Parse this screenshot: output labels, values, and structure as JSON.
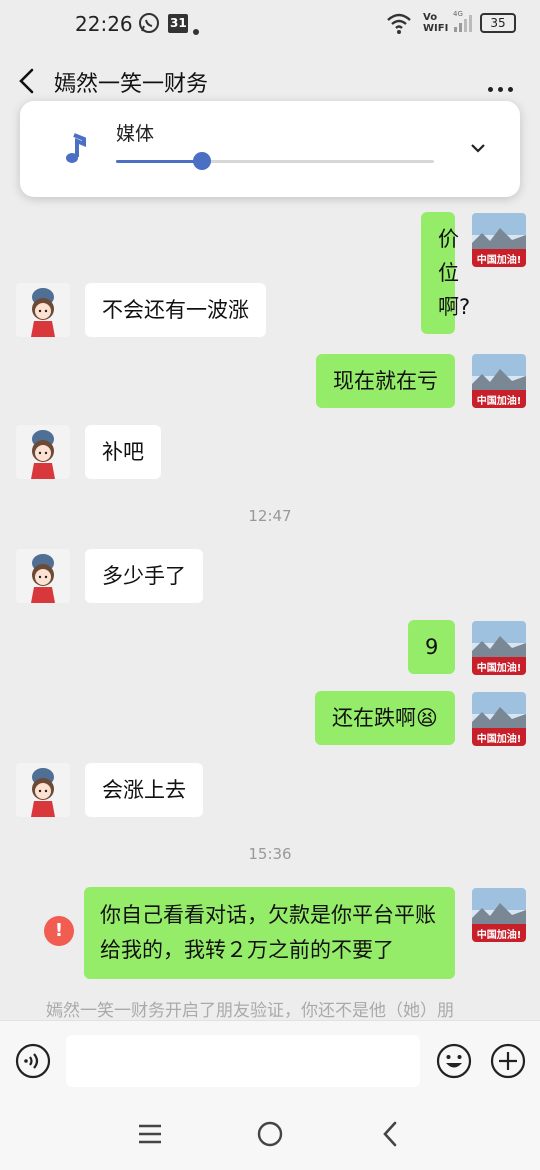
{
  "status_bar": {
    "time": "22:26",
    "calendar_day": "31",
    "network_label_top": "Vo",
    "network_label_bottom": "WIFI",
    "signal_label": "4G",
    "battery": "35"
  },
  "header": {
    "title": "嫣然一笑一财务",
    "back_icon": "chevron-left-icon",
    "more_icon": "more-dots-icon"
  },
  "media_panel": {
    "label": "媒体",
    "volume_level": 0.27,
    "accent_color": "#4a6fc3"
  },
  "messages": [
    {
      "side": "out",
      "text": "价位啊?"
    },
    {
      "side": "in",
      "text": "不会还有一波涨"
    },
    {
      "side": "out",
      "text": "现在就在亏"
    },
    {
      "side": "in",
      "text": "补吧"
    },
    {
      "side": "time",
      "text": "12:47"
    },
    {
      "side": "in",
      "text": "多少手了"
    },
    {
      "side": "out",
      "text": "9"
    },
    {
      "side": "out",
      "text": "还在跌啊😫"
    },
    {
      "side": "in",
      "text": "会涨上去"
    },
    {
      "side": "time",
      "text": "15:36"
    },
    {
      "side": "out",
      "text": "你自己看看对话，欠款是你平台平账给我的，我转２万之前的不要了",
      "failed": true
    }
  ],
  "avatar_caption": "中国加油!",
  "notice": "嫣然一笑一财务开启了朋友验证，你还不是他（她）朋",
  "input_bar": {
    "voice_icon": "voice-icon",
    "emoji_icon": "emoji-icon",
    "plus_icon": "plus-icon",
    "value": ""
  },
  "colors": {
    "bubble_out": "#95ec69",
    "bubble_in": "#ffffff",
    "background": "#ededed",
    "error": "#f25d52"
  }
}
